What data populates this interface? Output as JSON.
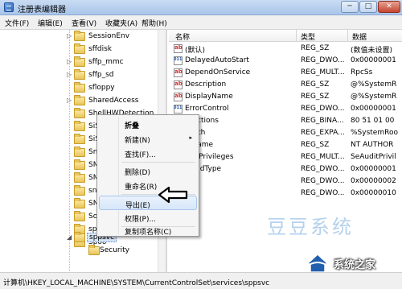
{
  "window": {
    "title": "注册表编辑器",
    "controls": {
      "minimize": "─",
      "maximize": "□",
      "close": "✕"
    }
  },
  "menubar": [
    "文件(F)",
    "编辑(E)",
    "查看(V)",
    "收藏夹(A)",
    "帮助(H)"
  ],
  "tree": {
    "items": [
      {
        "label": "SessionEnv"
      },
      {
        "label": "sffdisk"
      },
      {
        "label": "sffp_mmc"
      },
      {
        "label": "sffp_sd"
      },
      {
        "label": "sfloppy"
      },
      {
        "label": "SharedAccess"
      },
      {
        "label": "ShellHWDetection"
      },
      {
        "label": "SiSRa"
      },
      {
        "label": "SiSRa"
      },
      {
        "label": "Smb"
      },
      {
        "label": "SMSv"
      },
      {
        "label": "SMSv"
      },
      {
        "label": "snap"
      },
      {
        "label": "SNM"
      },
      {
        "label": "Sogo"
      },
      {
        "label": "spldr"
      },
      {
        "label": "Spoo"
      },
      {
        "label": "sppsvc"
      },
      {
        "label": "Security"
      }
    ]
  },
  "values": {
    "headers": {
      "name": "名称",
      "type": "类型",
      "data": "数据"
    },
    "rows": [
      {
        "name": "(默认)",
        "type": "REG_SZ",
        "data": "(数值未设置)",
        "icon": "sz"
      },
      {
        "name": "DelayedAutoStart",
        "type": "REG_DWO...",
        "data": "0x00000001",
        "icon": "bin"
      },
      {
        "name": "DependOnService",
        "type": "REG_MULT...",
        "data": "RpcSs",
        "icon": "sz"
      },
      {
        "name": "Description",
        "type": "REG_SZ",
        "data": "@%SystemR",
        "icon": "sz"
      },
      {
        "name": "DisplayName",
        "type": "REG_SZ",
        "data": "@%SystemR",
        "icon": "sz"
      },
      {
        "name": "ErrorControl",
        "type": "REG_DWO...",
        "data": "0x00000001",
        "icon": "bin"
      },
      {
        "name": "reActions",
        "type": "REG_BINA...",
        "data": "80 51 01 00",
        "icon": "bin"
      },
      {
        "name": "ePath",
        "type": "REG_EXPA...",
        "data": "%SystemRoo",
        "icon": "sz"
      },
      {
        "name": "ctName",
        "type": "REG_SZ",
        "data": "NT AUTHOR",
        "icon": "sz"
      },
      {
        "name": "iredPrivileges",
        "type": "REG_MULT...",
        "data": "SeAuditPrivil",
        "icon": "sz"
      },
      {
        "name": "ceSidType",
        "type": "REG_DWO...",
        "data": "0x00000001",
        "icon": "bin"
      },
      {
        "name": "",
        "type": "REG_DWO...",
        "data": "0x00000002",
        "icon": "bin"
      },
      {
        "name": "",
        "type": "REG_DWO...",
        "data": "0x00000010",
        "icon": "bin"
      }
    ]
  },
  "context_menu": {
    "items": [
      {
        "label": "折叠",
        "bold": true
      },
      {
        "label": "新建(N)",
        "submenu": "▸"
      },
      {
        "label": "查找(F)..."
      },
      {
        "label": "删除(D)"
      },
      {
        "label": "重命名(R)"
      },
      {
        "label": "导出(E)",
        "hover": true
      },
      {
        "label": "权限(P)..."
      },
      {
        "label": "复制项名称(C)"
      }
    ]
  },
  "statusbar": {
    "path": "计算机\\HKEY_LOCAL_MACHINE\\SYSTEM\\CurrentControlSet\\services\\sppsvc"
  },
  "watermark": {
    "line1": "豆豆系统",
    "line2": "系统之家"
  },
  "icons": {
    "app": "registry-editor-icon",
    "folder": "folder-icon",
    "expand": "chevron-right-icon",
    "pointer": "arrow-pointer-icon"
  },
  "colors": {
    "titlebar": "#b7d0ee",
    "menu_hover": "#d6e6f9",
    "folder": "#e8c55a"
  }
}
